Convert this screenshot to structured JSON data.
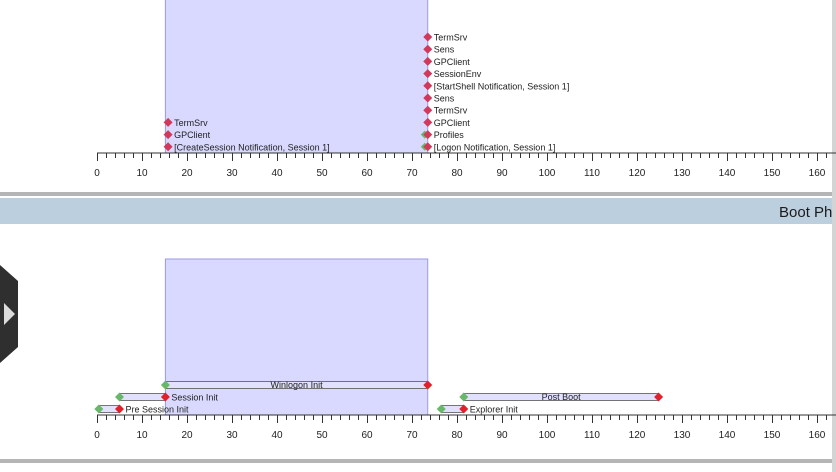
{
  "window": {
    "frame_color": "#555555",
    "band_color": "#bccfde",
    "selection_color": "#d9d9ff"
  },
  "section_title": "Boot Ph",
  "axis_ticks": [
    "0",
    "10",
    "20",
    "30",
    "40",
    "50",
    "60",
    "70",
    "80",
    "90",
    "100",
    "110",
    "120",
    "130",
    "140",
    "150",
    "160"
  ],
  "axis_range": [
    0,
    163
  ],
  "selection_range": [
    15.2,
    73.5
  ],
  "markers_top": [
    {
      "label": "TermSrv",
      "time": 73.5,
      "row": 0,
      "start_color": "#d2385b"
    },
    {
      "label": "Sens",
      "time": 73.5,
      "row": 1,
      "start_color": "#d2385b"
    },
    {
      "label": "GPClient",
      "time": 73.5,
      "row": 2,
      "start_color": "#d2385b"
    },
    {
      "label": "SessionEnv",
      "time": 73.5,
      "row": 3,
      "start_color": "#d2385b"
    },
    {
      "label": "[StartShell Notification, Session 1]",
      "time": 73.5,
      "row": 4,
      "start_color": "#d2385b"
    },
    {
      "label": "Sens",
      "time": 73.5,
      "row": 5,
      "start_color": "#d2385b"
    },
    {
      "label": "TermSrv",
      "time": 73.5,
      "row": 6,
      "start_color": "#d2385b"
    },
    {
      "label": "GPClient",
      "time": 73.5,
      "row": 7,
      "start_color": "#d2385b"
    },
    {
      "label": "Profiles",
      "time": 73.5,
      "row": 8,
      "start_color": "#69b869"
    },
    {
      "label": "[Logon Notification, Session 1]",
      "time": 73.5,
      "row": 9,
      "start_color": "#69b869"
    },
    {
      "label": "TermSrv",
      "time": 15.8,
      "row": 7,
      "start_color": "#d2385b"
    },
    {
      "label": "GPClient",
      "time": 15.8,
      "row": 8,
      "start_color": "#d2385b"
    },
    {
      "label": "[CreateSession Notification, Session 1]",
      "time": 15.8,
      "row": 9,
      "start_color": "#d2385b"
    }
  ],
  "phases": [
    {
      "label": "Winlogon Init",
      "start": 15.2,
      "end": 73.5,
      "row": 0,
      "label_position": "inside"
    },
    {
      "label": "Session Init",
      "start": 5.0,
      "end": 15.2,
      "row": 1,
      "label_position": "after"
    },
    {
      "label": "Post Boot",
      "start": 81.5,
      "end": 124.8,
      "row": 1,
      "label_position": "inside"
    },
    {
      "label": "Pre Session Init",
      "start": 0.4,
      "end": 5.0,
      "row": 2,
      "label_position": "after"
    },
    {
      "label": "Explorer Init",
      "start": 76.5,
      "end": 81.5,
      "row": 2,
      "label_position": "after"
    }
  ],
  "colors": {
    "marker": "#d2385b",
    "marker_green": "#69b869",
    "phase_start": "#69b869",
    "phase_end": "#e0202a",
    "phase_fill": "#e1e1ff",
    "selection_edge": "#9a9ae6"
  }
}
